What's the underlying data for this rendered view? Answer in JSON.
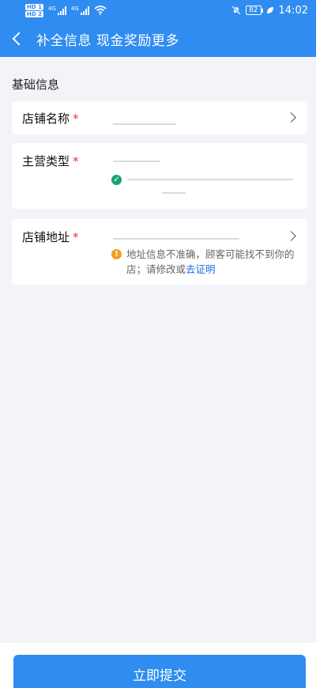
{
  "status_bar": {
    "hd_labels": [
      "HD 1",
      "HD 2"
    ],
    "signal_labels": [
      "4G",
      "4G"
    ],
    "battery": "82",
    "time": "14:02"
  },
  "nav": {
    "title": "补全信息 现金奖励更多"
  },
  "section": {
    "title": "基础信息"
  },
  "form": {
    "store_name": {
      "label": "店铺名称",
      "required_mark": "*"
    },
    "business_type": {
      "label": "主营类型",
      "required_mark": "*"
    },
    "store_address": {
      "label": "店铺地址",
      "required_mark": "*",
      "warning_text": "地址信息不准确，顾客可能找不到你的店；请修改或",
      "warning_link": "去证明",
      "warning_icon_char": "!"
    }
  },
  "colors": {
    "primary": "#2f8cf0",
    "required": "#e33333",
    "warning": "#f0a020",
    "success": "#1aa37a",
    "link": "#1a73e8"
  },
  "submit_button": {
    "label": "立即提交"
  }
}
